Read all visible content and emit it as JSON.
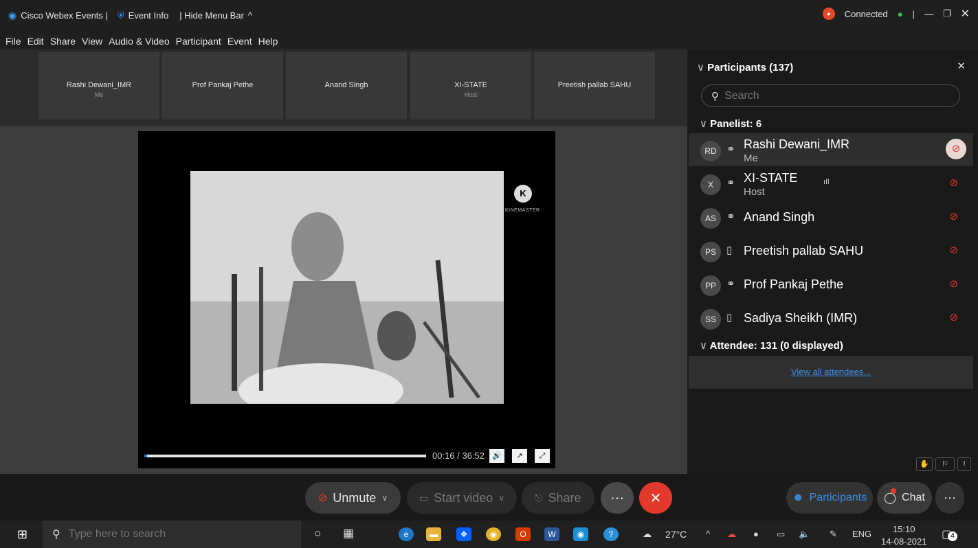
{
  "titlebar": {
    "app_name": "Cisco Webex Events |",
    "event_info": "Event Info",
    "hide_menu": "| Hide Menu Bar",
    "status": "Connected"
  },
  "menu": [
    "File",
    "Edit",
    "Share",
    "View",
    "Audio & Video",
    "Participant",
    "Event",
    "Help"
  ],
  "tiles": [
    {
      "name": "Rashi Dewani_IMR",
      "sub": "Me"
    },
    {
      "name": "Prof Pankaj Pethe",
      "sub": ""
    },
    {
      "name": "Anand Singh",
      "sub": ""
    },
    {
      "name": "XI-STATE",
      "sub": "Host"
    },
    {
      "name": "Preetish pallab SAHU",
      "sub": ""
    }
  ],
  "player": {
    "watermark": "KINEMASTER",
    "time": "00:16 / 36:52",
    "progress_fraction": 0.007
  },
  "panel": {
    "title": "Participants (137)",
    "search_placeholder": "Search",
    "panelist_header": "Panelist: 6",
    "panelists": [
      {
        "initials": "RD",
        "name": "Rashi Dewani_IMR",
        "role": "Me"
      },
      {
        "initials": "X",
        "name": "XI-STATE",
        "role": "Host"
      },
      {
        "initials": "AS",
        "name": "Anand Singh",
        "role": ""
      },
      {
        "initials": "PS",
        "name": "Preetish pallab SAHU",
        "role": ""
      },
      {
        "initials": "PP",
        "name": "Prof Pankaj Pethe",
        "role": ""
      },
      {
        "initials": "SS",
        "name": "Sadiya Sheikh (IMR)",
        "role": ""
      }
    ],
    "attendee_header": "Attendee: 131 (0 displayed)",
    "view_all": "View all attendees..."
  },
  "controls": {
    "unmute": "Unmute",
    "start_video": "Start video",
    "share": "Share",
    "participants": "Participants",
    "chat": "Chat"
  },
  "taskbar": {
    "search_placeholder": "Type here to search",
    "weather": "27°C",
    "lang": "ENG",
    "time": "15:10",
    "date": "14-08-2021",
    "notifications": "4"
  },
  "colors": {
    "accent": "#2a7ce0",
    "end_call": "#e2392a",
    "mute_red": "#e33333",
    "panel_bg": "#1a1a1a",
    "link": "#3b8de0"
  }
}
